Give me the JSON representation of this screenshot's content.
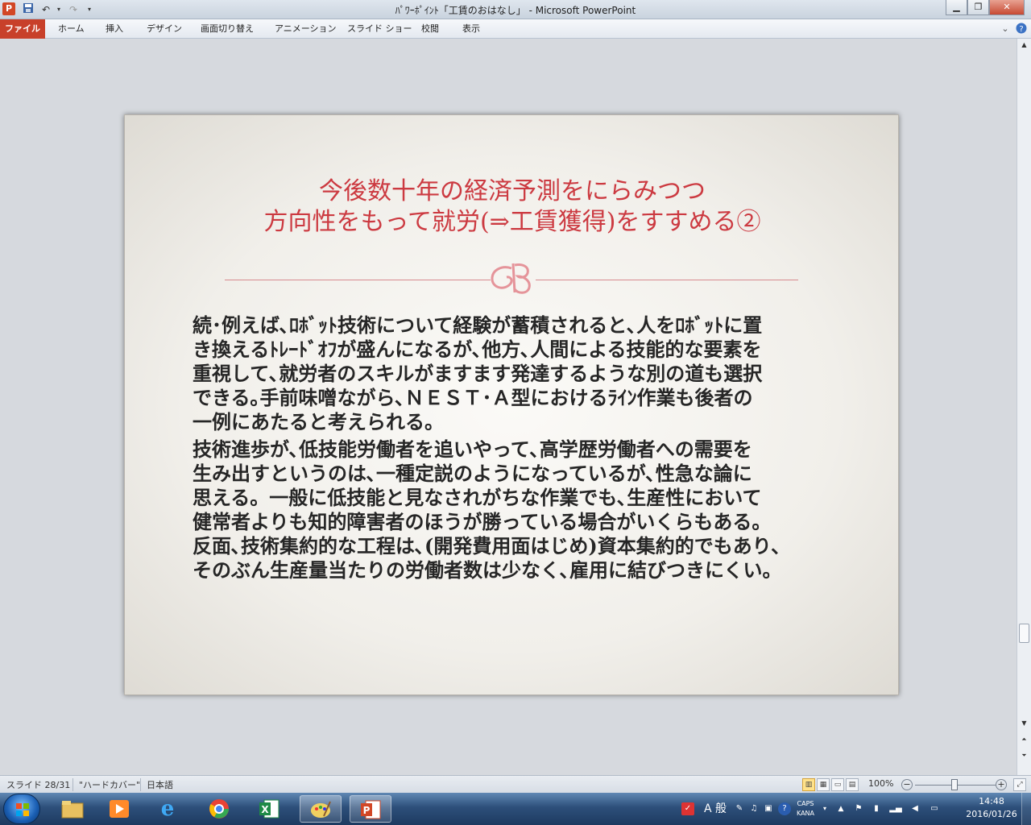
{
  "window": {
    "title": "ﾊﾟﾜｰﾎﾟｲﾝﾄ「工賃のおはなし」 - Microsoft PowerPoint",
    "minimize_icon": "minimize-icon",
    "maximize_icon": "restore-icon",
    "close_icon": "close-icon"
  },
  "quick_access": {
    "app_icon_letter": "P",
    "save_icon": "save-icon",
    "undo_icon": "undo-icon",
    "redo_icon": "redo-icon",
    "customize_icon": "customize-icon"
  },
  "ribbon": {
    "tabs": [
      "ファイル",
      "ホーム",
      "挿入",
      "デザイン",
      "画面切り替え",
      "アニメーション",
      "スライド ショー",
      "校閲",
      "表示"
    ]
  },
  "slide": {
    "title_lines": [
      "今後数十年の経済予測をにらみつつ",
      "方向性をもって就労(⇒工賃獲得)をすすめる②"
    ],
    "body_paragraphs": [
      [
        "続･例えば､ﾛﾎﾞｯﾄ技術について経験が蓄積されると､人をﾛﾎﾞｯﾄに置",
        "き換えるﾄﾚｰﾄﾞｵﾌが盛んになるが､他方､人間による技能的な要素を",
        "重視して､就労者のスキルがますます発達するような別の道も選択",
        "できる｡手前味噌ながら､ＮＥＳＴ･Ａ型におけるﾗｲﾝ作業も後者の",
        "一例にあたると考えられる。"
      ],
      [
        "技術進歩が､低技能労働者を追いやって､高学歴労働者への需要を",
        "生み出すというのは､一種定説のようになっているが､性急な論に",
        "思える。一般に低技能と見なされがちな作業でも､生産性において",
        "健常者よりも知的障害者のほうが勝っている場合がいくらもある。",
        "反面､技術集約的な工程は､(開発費用面はじめ)資本集約的でもあり､",
        "そのぶん生産量当たりの労働者数は少なく､雇用に結びつきにくい。"
      ]
    ],
    "accent_color": "#cc3a41"
  },
  "status_bar": {
    "slide_info": "スライド 28/31",
    "theme": "\"ハードカバー\"",
    "language": "日本語",
    "zoom": "100%",
    "zoom_minus": "−",
    "zoom_plus": "+"
  },
  "taskbar": {
    "pinned": [
      {
        "name": "file-explorer",
        "glyph": "▤",
        "color": "#e8c060"
      },
      {
        "name": "media-player",
        "glyph": "▶",
        "color": "#ff8a2a"
      },
      {
        "name": "internet-explorer",
        "glyph": "e",
        "color": "#3fa9f5"
      },
      {
        "name": "chrome",
        "glyph": "●",
        "color": "#e94235"
      },
      {
        "name": "excel",
        "glyph": "X",
        "color": "#1f8a46"
      },
      {
        "name": "paint",
        "glyph": "✎",
        "color": "#f0d060"
      },
      {
        "name": "powerpoint",
        "glyph": "P",
        "color": "#d24726"
      }
    ],
    "ime_mode": "A 般",
    "caps_label": "CAPS",
    "kana_label": "KANA",
    "time": "14:48",
    "date": "2016/01/26"
  }
}
